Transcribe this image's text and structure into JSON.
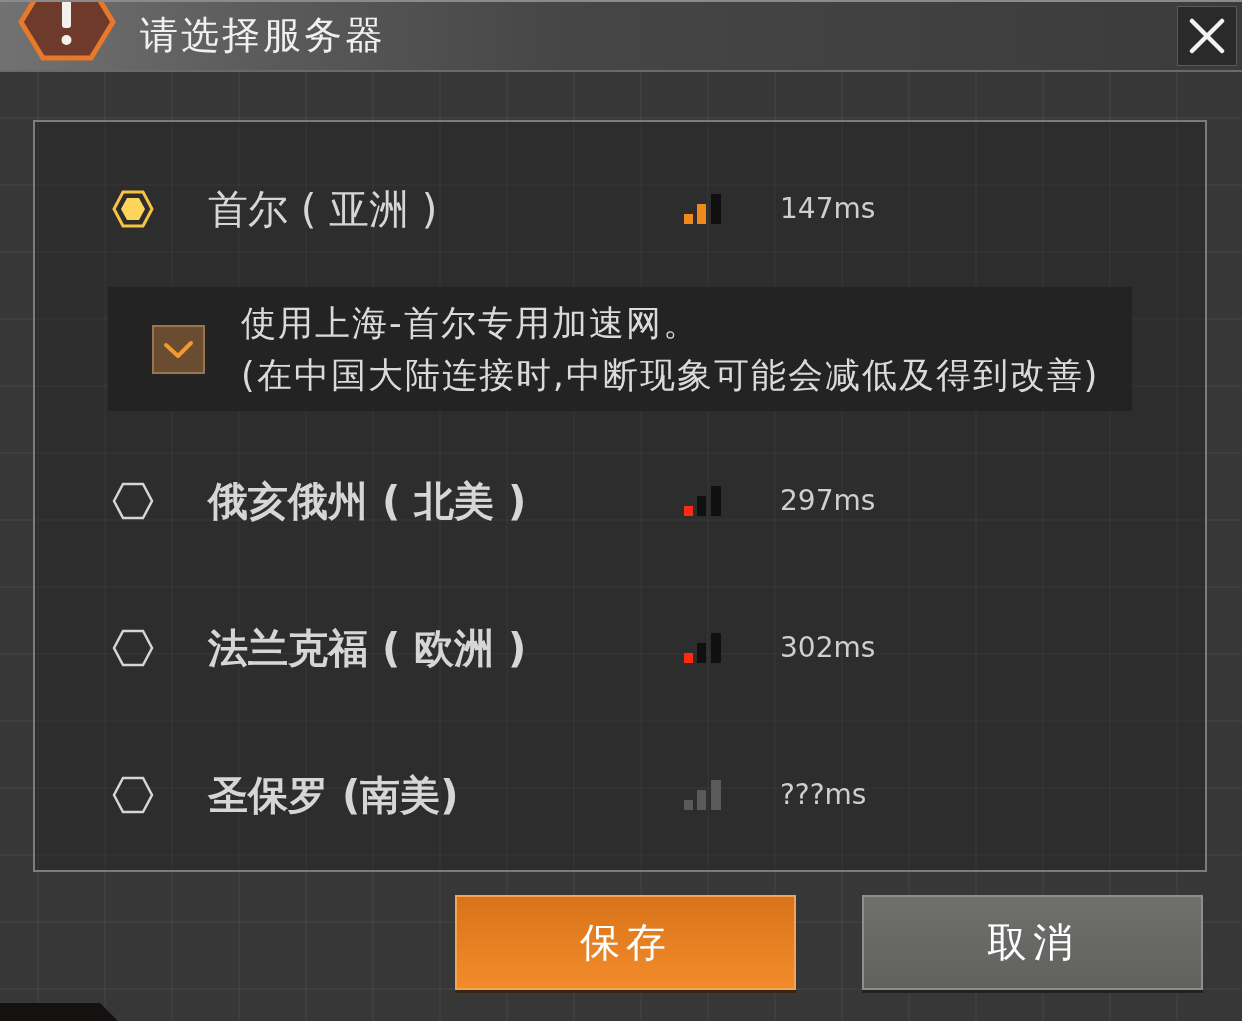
{
  "dialog": {
    "title": "请选择服务器"
  },
  "servers": [
    {
      "name": "首尔 ( 亚洲 )",
      "kind": "fair",
      "ping": "147ms",
      "selected": true,
      "accelerator": {
        "label": "使用上海-首尔专用加速网。",
        "note": "(在中国大陆连接时,中断现象可能会减低及得到改善)",
        "checked": true
      }
    },
    {
      "name": "俄亥俄州 ( 北美 )",
      "kind": "weak",
      "ping": "297ms",
      "selected": false
    },
    {
      "name": "法兰克福 ( 欧洲 )",
      "kind": "weak",
      "ping": "302ms",
      "selected": false
    },
    {
      "name": "圣保罗 (南美)",
      "kind": "unknown",
      "ping": "???ms",
      "selected": false
    }
  ],
  "buttons": [
    {
      "kind": "primary",
      "label": "保存"
    },
    {
      "kind": "secondary",
      "label": "取消"
    }
  ]
}
